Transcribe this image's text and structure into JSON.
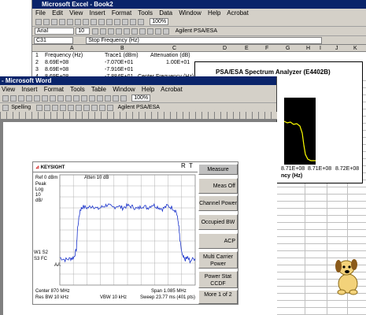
{
  "excel": {
    "title": "Microsoft Excel - Book2",
    "menu": [
      "File",
      "Edit",
      "View",
      "Insert",
      "Format",
      "Tools",
      "Data",
      "Window",
      "Help",
      "Acrobat"
    ],
    "zoom": "100%",
    "font_name": "Arial",
    "font_size": "10",
    "cell_ref": "C31",
    "formula": "Stop Frequency (Hz)",
    "addin_label": "Agilent PSA/ESA",
    "columns": [
      "A",
      "B",
      "C",
      "D",
      "E",
      "F",
      "G",
      "H",
      "I",
      "J",
      "K"
    ],
    "rows": [
      {
        "num": "1",
        "a": "Frequency (Hz)",
        "b": "Trace1 (dBm)",
        "c": "Attenuation (dB)"
      },
      {
        "num": "2",
        "a": "8.69E+08",
        "b": "-7.070E+01",
        "c": "1.00E+01"
      },
      {
        "num": "3",
        "a": "8.69E+08",
        "b": "-7.916E+01",
        "c": ""
      },
      {
        "num": "4",
        "a": "8.69E+08",
        "b": "-7.884E+01",
        "c": "Center Frequency (Hz)"
      }
    ]
  },
  "excel_chart": {
    "title": "PSA/ESA Spectrum Analyzer (E4402B)",
    "ticks": [
      "8.71E+08",
      "8.71E+08",
      "8.72E+08"
    ],
    "xlabel": "ncy (Hz)"
  },
  "word": {
    "title": "- Microsoft Word",
    "menu": [
      "View",
      "Insert",
      "Format",
      "Tools",
      "Table",
      "Window",
      "Help",
      "Acrobat"
    ],
    "zoom": "100%",
    "spelling": "Spelling",
    "addin_label": "Agilent PSA/ESA"
  },
  "analyzer": {
    "brand": "KEYSIGHT",
    "indicators": [
      "R",
      "T"
    ],
    "ref": "Ref 0 dBm",
    "atten": "Atten 10 dB",
    "left_labels": [
      "Peak",
      "Log",
      "10",
      "dB/"
    ],
    "lower_labels": [
      "W1 S2",
      "S3 FC",
      "AA"
    ],
    "center": "Center 870 MHz",
    "span": "Span 1.085 MHz",
    "res_bw": "Res BW 10 kHz",
    "vbw": "VBW 10 kHz",
    "sweep": "Sweep 23.77 ms (401 pts)",
    "softkeys": [
      "Measure",
      "Meas Off",
      "Channel Power",
      "Occupied BW",
      "ACP",
      "Multi Carrier Power",
      "Power Stat CCDF",
      "More 1 of 2"
    ]
  },
  "chart_data": {
    "type": "line",
    "title": "",
    "xlabel": "",
    "ylabel": "",
    "xlim": [
      869457500,
      870542500
    ],
    "ylim": [
      -100,
      0
    ],
    "series": [
      {
        "x": [
          869457500,
          869500000,
          869540000,
          869570000,
          869590000,
          869600000,
          869620000,
          869640000,
          869680000,
          869720000,
          869760000,
          869800000,
          869840000,
          869880000,
          869920000,
          869960000,
          870000000,
          870040000,
          870080000,
          870120000,
          870160000,
          870200000,
          870240000,
          870280000,
          870320000,
          870360000,
          870390000,
          870410000,
          870420000,
          870440000,
          870460000,
          870480000,
          870500000,
          870542500
        ],
        "y": [
          -75,
          -77,
          -76,
          -75,
          -68,
          -48,
          -32,
          -29,
          -30,
          -28,
          -31,
          -29,
          -27,
          -30,
          -28,
          -30,
          -28,
          -29,
          -31,
          -28,
          -30,
          -27,
          -29,
          -31,
          -28,
          -30,
          -33,
          -45,
          -60,
          -74,
          -77,
          -75,
          -78,
          -76
        ]
      }
    ]
  },
  "colors": {
    "title_bar": "#0a246a",
    "chrome": "#d4d0c8",
    "trace": "#1a33cc",
    "excel_chart_trace": "#ffff00",
    "chart_bg": "#000000"
  }
}
